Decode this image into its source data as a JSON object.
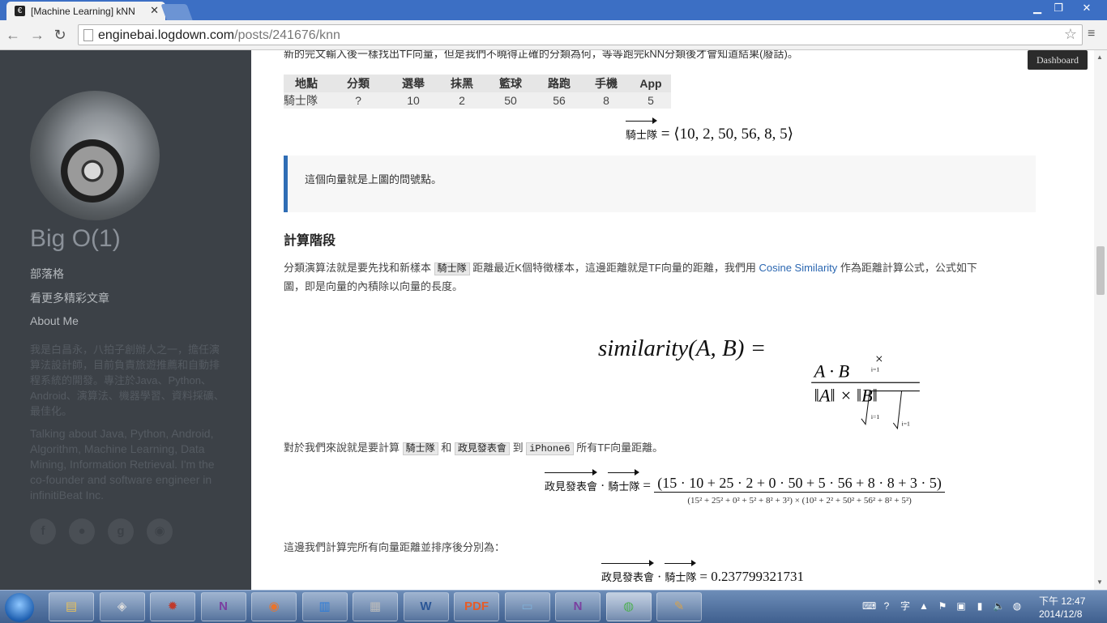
{
  "browser": {
    "tab_title": "[Machine Learning] kNN",
    "tab_favicon": "€",
    "url_host": "enginebai.logdown.com",
    "url_path": "/posts/241676/knn",
    "icons": [
      "back-icon",
      "forward-icon",
      "reload-icon",
      "page-icon",
      "bookmark-star-icon",
      "menu-icon"
    ],
    "window_controls": [
      "minimize-icon",
      "maximize-icon",
      "close-icon"
    ]
  },
  "sidebar": {
    "blog_title": "Big O(1)",
    "links": [
      "部落格",
      "看更多精彩文章",
      "About Me"
    ],
    "bio_zh": "我是白昌永，八拍子創辦人之一，擔任演算法設計師，目前負責旅遊推薦和自動排程系統的開發。專注於Java、Python、Android、演算法、機器學習、資料採礦、最佳化。",
    "bio_en": "Talking about Java, Python, Android, Algorithm, Machine Learning, Data Mining, Information Retrieval. I'm the co-founder and software engineer in infinitiBeat Inc.",
    "social": [
      "facebook-icon",
      "github-icon",
      "google-plus-icon",
      "rss-icon"
    ],
    "social_glyphs": [
      "f",
      "●",
      "g",
      "◉"
    ]
  },
  "main": {
    "top_line": "新的完文輸入後一樣找出TF向量，但是我們不曉得正確的分類為何，等等跑完kNN分類後才會知道結果(廢話)。",
    "dashboard": "Dashboard",
    "table": {
      "headers": [
        "地點",
        "分類",
        "選舉",
        "抹黑",
        "籃球",
        "路跑",
        "手機",
        "App"
      ],
      "rows": [
        [
          "騎士隊",
          "?",
          "10",
          "2",
          "50",
          "56",
          "8",
          "5"
        ]
      ]
    },
    "eq1": {
      "vector": "騎士隊",
      "rhs": "= ⟨10, 2, 50, 56, 8, 5⟩"
    },
    "quote": "這個向量就是上圖的問號點。",
    "section_title": "計算階段",
    "para1": {
      "a": "分類演算法就是要先找和新樣本",
      "code": "騎士隊",
      "b": "距離最近K個特徵樣本，這邊距離就是TF向量的距離，我們用",
      "link": "Cosine Similarity",
      "c": "作為距離計算公式，公式如下",
      "d": "圖，即是向量的內積除以向量的長度。"
    },
    "sim_eq": {
      "lhs": "similarity(A, B) =",
      "num": "A · B",
      "den": "‖A‖ × ‖B‖",
      "sum_sym": "i=1"
    },
    "para2": {
      "a": "對於我們來說就是要計算",
      "code1": "騎士隊",
      "b": "和",
      "code2": "政見發表會",
      "c": "到",
      "code3": "iPhone6",
      "d": "所有TF向量距離。"
    },
    "eq3": {
      "v1": "政見發表會",
      "v2": "騎士隊",
      "num": "(15 · 10 + 25 · 2 + 0 · 50 + 5 · 56 + 8 · 8 + 3 · 5)",
      "den": "(15² + 25² + 0² + 5² + 8² + 3²) × (10² + 2² + 50² + 56² + 8² + 5²)"
    },
    "para3": "這邊我們計算完所有向量距離並排序後分別為：",
    "eq4": {
      "v1": "政見發表會",
      "v2": "騎士隊",
      "rhs": "= 0.237799321731"
    }
  },
  "taskbar": {
    "apps": [
      "windows-explorer-icon",
      "alienware-icon",
      "app-icon",
      "onenote-icon",
      "firefox-icon",
      "app-chart-icon",
      "calculator-icon",
      "word-icon",
      "pdf-icon",
      "notepad-icon",
      "onenote-clip-icon",
      "chrome-icon",
      "paint-icon"
    ],
    "app_glyphs": [
      "▤",
      "◈",
      "✹",
      "N",
      "◉",
      "▥",
      "▦",
      "W",
      "PDF",
      "▭",
      "N",
      "◍",
      "✎"
    ],
    "app_colors": [
      "#e8c15a",
      "#dddddd",
      "#c0392b",
      "#7b3fa0",
      "#e8742d",
      "#2a7bd8",
      "#bbbbbb",
      "#2b5797",
      "#e65c28",
      "#7fb1d9",
      "#7b3fa0",
      "#4caf50",
      "#d6a24d"
    ],
    "tray_icons": [
      "keyboard-icon",
      "help-icon",
      "language-icon",
      "up-arrow-icon",
      "flag-icon",
      "device-icon",
      "network-icon",
      "volume-icon",
      "shield-icon"
    ],
    "tray_glyphs": [
      "⌨",
      "?",
      "字",
      "▲",
      "⚑",
      "▣",
      "▮",
      "🔈",
      "◍"
    ],
    "time": "下午 12:47",
    "date": "2014/12/8"
  }
}
